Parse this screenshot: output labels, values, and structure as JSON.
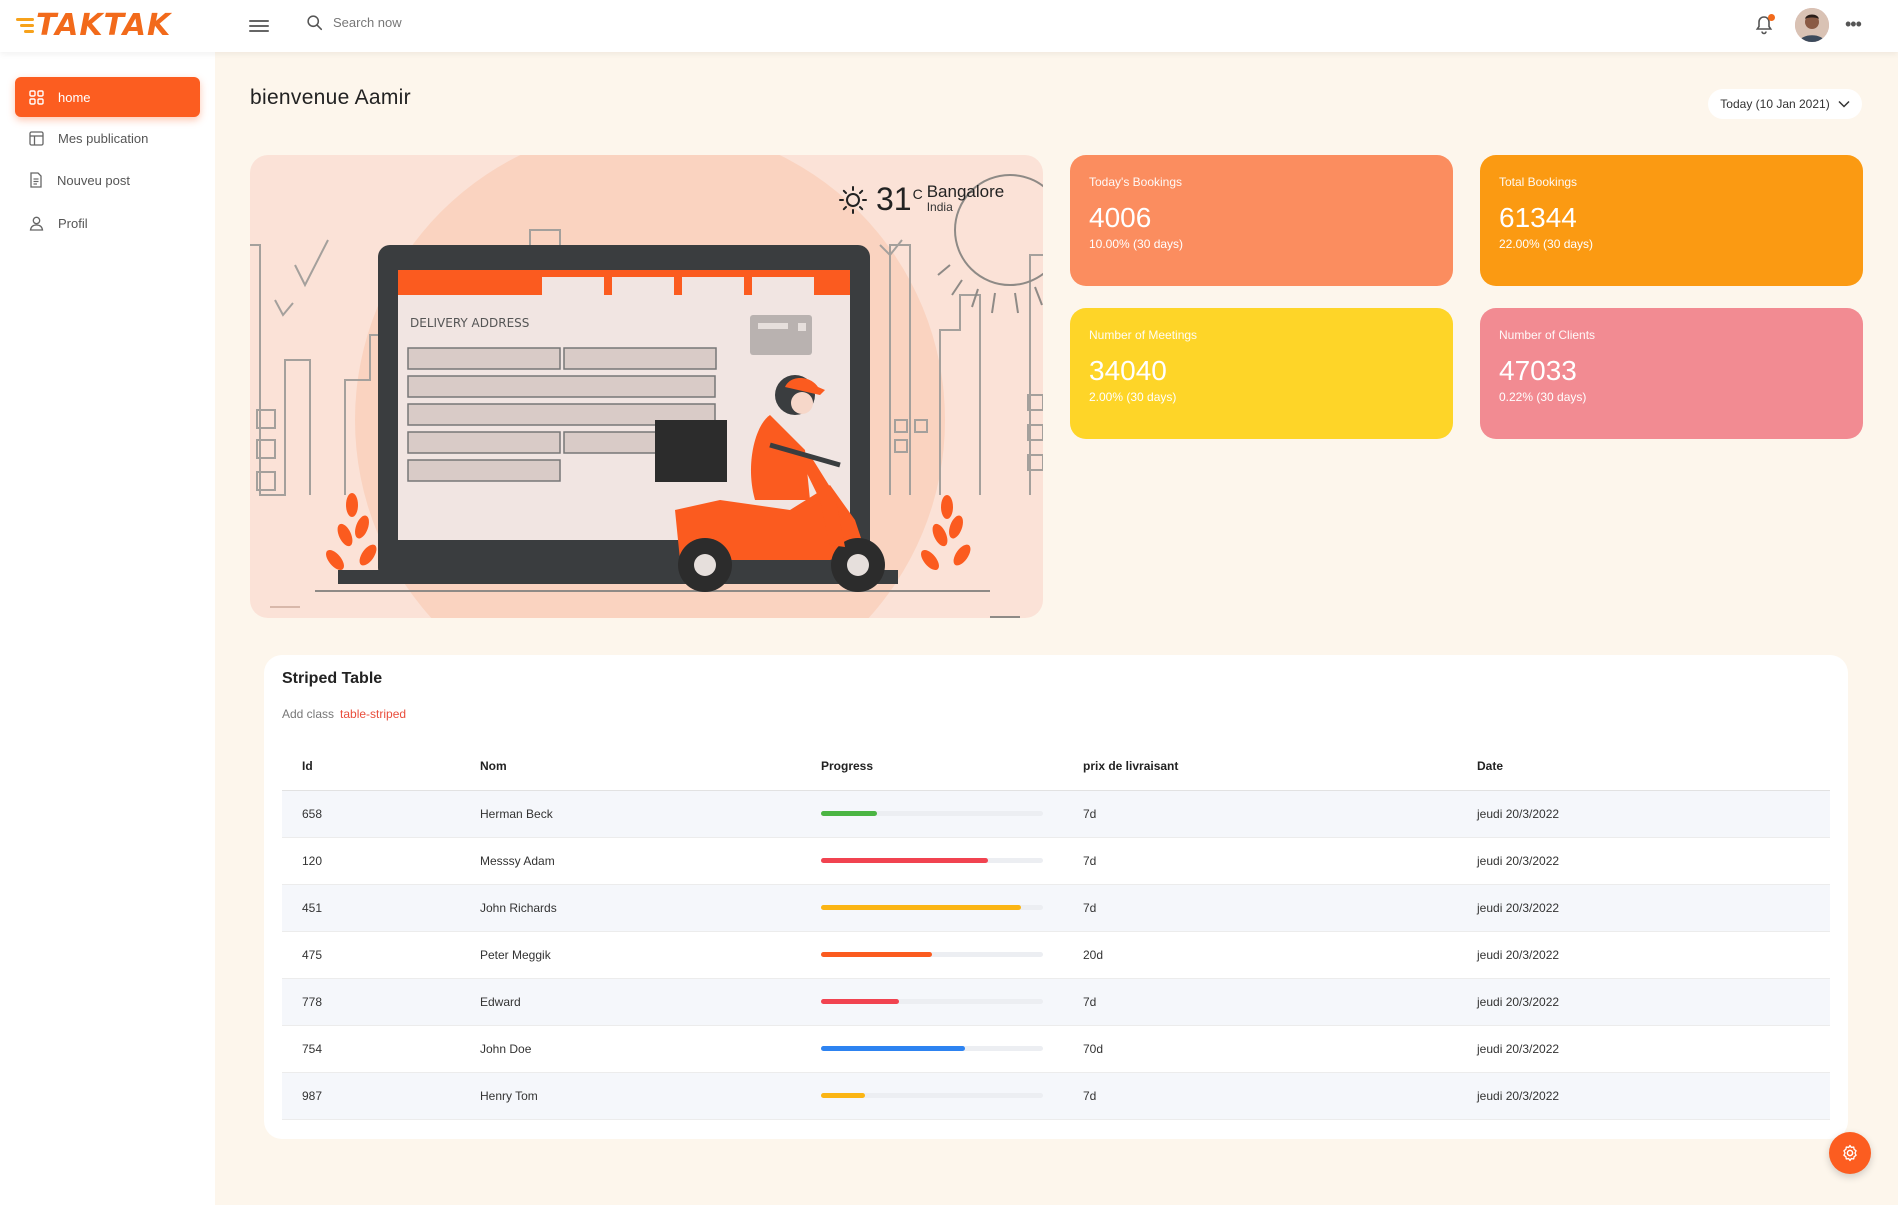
{
  "header": {
    "logo_text": "TAKTAK",
    "search_placeholder": "Search now"
  },
  "sidebar": {
    "items": [
      {
        "label": "home",
        "icon": "grid-icon",
        "active": true
      },
      {
        "label": "Mes publication",
        "icon": "layout-icon",
        "active": false
      },
      {
        "label": "Nouveu post",
        "icon": "document-icon",
        "active": false
      },
      {
        "label": "Profil",
        "icon": "user-icon",
        "active": false
      }
    ]
  },
  "main": {
    "welcome": "bienvenue Aamir",
    "date_filter": "Today (10 Jan 2021)"
  },
  "weather": {
    "temp": "31",
    "unit": "C",
    "city": "Bangalore",
    "country": "India"
  },
  "hero": {
    "form_title": "DELIVERY ADDRESS"
  },
  "stats": [
    {
      "label": "Today's Bookings",
      "value": "4006",
      "sub": "10.00% (30 days)",
      "color": "#fb8d5f"
    },
    {
      "label": "Total Bookings",
      "value": "61344",
      "sub": "22.00% (30 days)",
      "color": "#fb9a12"
    },
    {
      "label": "Number of Meetings",
      "value": "34040",
      "sub": "2.00% (30 days)",
      "color": "#fed528"
    },
    {
      "label": "Number of Clients",
      "value": "47033",
      "sub": "0.22% (30 days)",
      "color": "#f28b92"
    }
  ],
  "table": {
    "title": "Striped Table",
    "subtitle": "Add class",
    "subtitle_code": "table-striped",
    "columns": [
      "Id",
      "Nom",
      "Progress",
      "prix de livraisant",
      "Date"
    ],
    "rows": [
      {
        "id": "658",
        "nom": "Herman Beck",
        "progress": 0.25,
        "color": "#4bb543",
        "prix": "7d",
        "date": "jeudi 20/3/2022"
      },
      {
        "id": "120",
        "nom": "Messsy Adam",
        "progress": 0.75,
        "color": "#f14350",
        "prix": "7d",
        "date": "jeudi 20/3/2022"
      },
      {
        "id": "451",
        "nom": "John Richards",
        "progress": 0.9,
        "color": "#fbb514",
        "prix": "7d",
        "date": "jeudi 20/3/2022"
      },
      {
        "id": "475",
        "nom": "Peter Meggik",
        "progress": 0.5,
        "color": "#fb5b1f",
        "prix": "20d",
        "date": "jeudi 20/3/2022"
      },
      {
        "id": "778",
        "nom": "Edward",
        "progress": 0.35,
        "color": "#f14350",
        "prix": "7d",
        "date": "jeudi 20/3/2022"
      },
      {
        "id": "754",
        "nom": "John Doe",
        "progress": 0.65,
        "color": "#2d83f1",
        "prix": "70d",
        "date": "jeudi 20/3/2022"
      },
      {
        "id": "987",
        "nom": "Henry Tom",
        "progress": 0.2,
        "color": "#fbb514",
        "prix": "7d",
        "date": "jeudi 20/3/2022"
      }
    ]
  }
}
